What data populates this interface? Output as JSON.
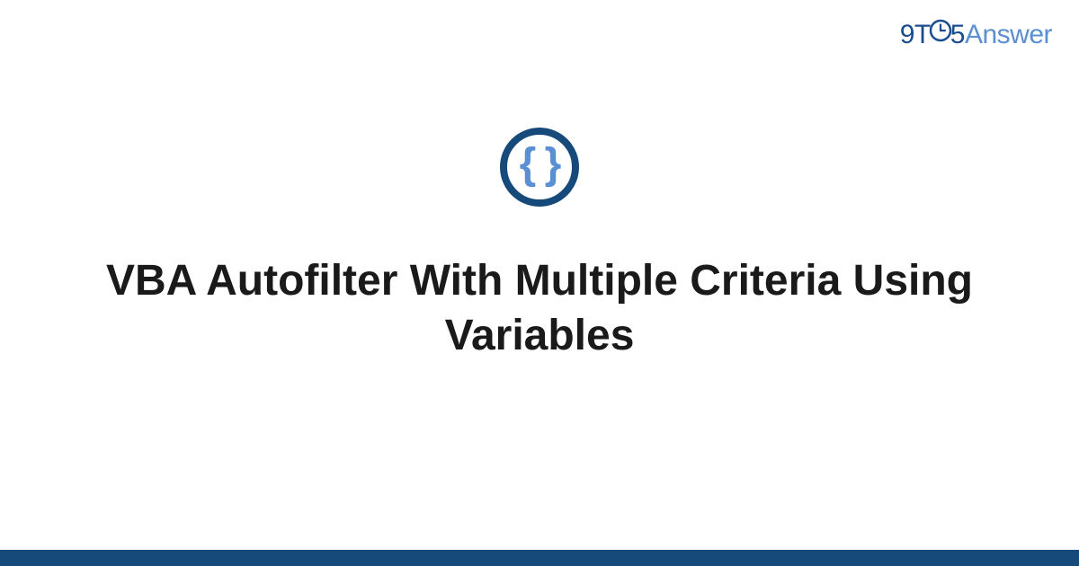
{
  "logo": {
    "part1": "9T",
    "part2": "5",
    "part3": "Answer"
  },
  "icon": {
    "braces": "{ }"
  },
  "title": "VBA Autofilter With Multiple Criteria Using Variables",
  "colors": {
    "brand_dark": "#164a7a",
    "brand_light": "#5a8fd4"
  }
}
